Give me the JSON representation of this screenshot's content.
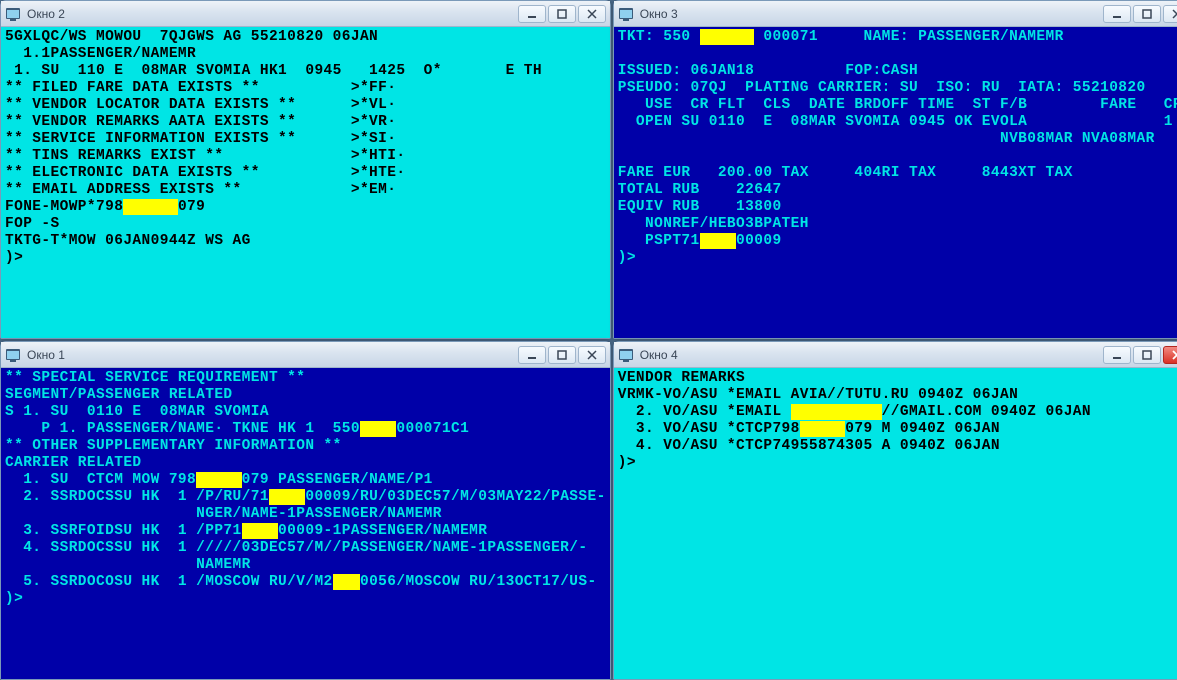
{
  "windows": {
    "w2": {
      "title": "Окно 2"
    },
    "w3": {
      "title": "Окно 3"
    },
    "w1": {
      "title": "Окно 1"
    },
    "w4": {
      "title": "Окно 4"
    }
  },
  "w2": {
    "l0": "5GXLQC/WS MOWOU  7QJGWS AG 55210820 06JAN",
    "l1": "  1.1PASSENGER/NAMEMR",
    "l2": " 1. SU  110 E  08MAR SVOMIA HK1  0945   1425  O*       E TH",
    "l3": "** FILED FARE DATA EXISTS **          >*FF·",
    "l4": "** VENDOR LOCATOR DATA EXISTS **      >*VL·",
    "l5": "** VENDOR REMARKS AATA EXISTS **      >*VR·",
    "l6": "** SERVICE INFORMATION EXISTS **      >*SI·",
    "l7": "** TINS REMARKS EXIST **              >*HTI·",
    "l8": "** ELECTRONIC DATA EXISTS **          >*HTE·",
    "l9": "** EMAIL ADDRESS EXISTS **            >*EM·",
    "l10a": "FONE-MOWP*798",
    "l10b": "      ",
    "l10c": "079",
    "l11": "FOP -S",
    "l12": "TKTG-T*MOW 06JAN0944Z WS AG",
    "l13": ")>"
  },
  "w3": {
    "l0a": "TKT: 550 ",
    "l0b": "      ",
    "l0c": " 000071     NAME: PASSENGER/NAMEMR",
    "l1": " ",
    "l2": "ISSUED: 06JAN18          FOP:CASH",
    "l3": "PSEUDO: 07QJ  PLATING CARRIER: SU  ISO: RU  IATA: 55210820",
    "l4": "   USE  CR FLT  CLS  DATE BRDOFF TIME  ST F/B        FARE   CPN",
    "l5": "  OPEN SU 0110  E  08MAR SVOMIA 0945 OK EVOLA               1",
    "l6": "                                          NVB08MAR NVA08MAR",
    "l7": " ",
    "l8": "FARE EUR   200.00 TAX     404RI TAX     8443XT TAX",
    "l9": "TOTAL RUB    22647",
    "l10": "EQUIV RUB    13800",
    "l11": "   NONREF/HEBO3BPATEH",
    "l12a": "   PSPT71",
    "l12b": "    ",
    "l12c": "00009",
    "l13": ")>"
  },
  "w1": {
    "l0": "** SPECIAL SERVICE REQUIREMENT **",
    "l1": "SEGMENT/PASSENGER RELATED",
    "l2": "S 1. SU  0110 E  08MAR SVOMIA",
    "l3a": "    P 1. PASSENGER/NAME· TKNE HK 1  550",
    "l3b": "    ",
    "l3c": "000071C1",
    "l4": "** OTHER SUPPLEMENTARY INFORMATION **",
    "l5": "CARRIER RELATED",
    "l6a": "  1. SU  CTCM MOW 798",
    "l6b": "     ",
    "l6c": "079 PASSENGER/NAME/P1",
    "l7a": "  2. SSRDOCSSU HK  1 /P/RU/71",
    "l7b": "    ",
    "l7c": "00009/RU/03DEC57/M/03MAY22/PASSE-",
    "l8": "                     NGER/NAME-1PASSENGER/NAMEMR",
    "l9a": "  3. SSRFOIDSU HK  1 /PP71",
    "l9b": "    ",
    "l9c": "00009-1PASSENGER/NAMEMR",
    "l10": "  4. SSRDOCSSU HK  1 /////03DEC57/M//PASSENGER/NAME-1PASSENGER/-",
    "l11": "                     NAMEMR",
    "l12a": "  5. SSRDOCOSU HK  1 /MOSCOW RU/V/M2",
    "l12b": "   ",
    "l12c": "0056/MOSCOW RU/13OCT17/US-",
    "l13": ")>"
  },
  "w4": {
    "l0": "VENDOR REMARKS",
    "l1": "VRMK-VO/ASU *EMAIL AVIA//TUTU.RU 0940Z 06JAN",
    "l2a": "  2. VO/ASU *EMAIL ",
    "l2b": "          ",
    "l2c": "//GMAIL.COM 0940Z 06JAN",
    "l3a": "  3. VO/ASU *CTCP798",
    "l3b": "     ",
    "l3c": "079 M 0940Z 06JAN",
    "l4": "  4. VO/ASU *CTCP74955874305 A 0940Z 06JAN",
    "l5": ")>"
  }
}
